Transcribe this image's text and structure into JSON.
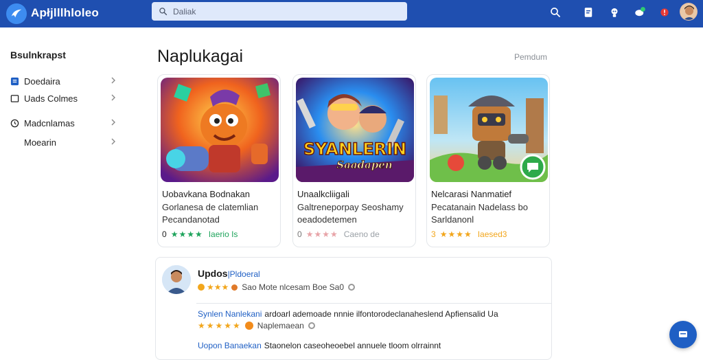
{
  "header": {
    "app_title": "Apłjlllhloleo",
    "search_placeholder": "Daliak",
    "accent_color": "#1f4fb0",
    "icons": [
      "search-icon",
      "document-icon",
      "support-icon",
      "chat-notification-icon",
      "alert-icon",
      "user-avatar"
    ]
  },
  "sidebar": {
    "title": "Bsulnkrapst",
    "items": [
      {
        "label": "Doedaira",
        "icon": "list-icon"
      },
      {
        "label": "Uads Colmes",
        "icon": "square-icon"
      },
      {
        "label": "Madcnlamas",
        "icon": "clock-icon"
      },
      {
        "label": "Moearin",
        "icon": ""
      }
    ]
  },
  "main": {
    "section_title": "Naplukagai",
    "section_link": "Pemdum",
    "cards": [
      {
        "title": "Uobavkana Bodnakan",
        "desc": "Gorlanesa de clatemlian Pecandanotad",
        "rating_value": "0",
        "stars": "★★★★",
        "star_color": "#1fa45c",
        "count": "Iaerio Is",
        "count_color": "#1fa45c"
      },
      {
        "title": "Unaalkcliigali",
        "desc": "Galtreneporpay Seoshamy oeadodetemen",
        "rating_value": "0",
        "stars": "★★★★",
        "star_color": "#e8a4a8",
        "count": "Caeno de",
        "count_color": "#9aa0a6",
        "art_text_1": "SYANLERIN",
        "art_text_2": "Saadapen"
      },
      {
        "title": "Nelcarasi Nanmatief",
        "desc": "Pecatanain Nadelass bo Sarldanonl",
        "rating_value": "3",
        "stars": "★★★★",
        "star_color": "#f2a61c",
        "count": "Iaesed3",
        "count_color": "#f2a61c"
      }
    ]
  },
  "reviews": {
    "author_name": "Updos",
    "author_role": "|Pldoeral",
    "author_stars": "★★★",
    "author_meta": "Sao Mote nlcesam Boe Sa0",
    "lines": [
      {
        "name": "Synlen Nanlekani",
        "text": "ardoarl ademoade nnnie ilfontorodeclanaheslend Apfiensalid Ua"
      },
      {
        "name": "Uopon Banaekan",
        "text": "Staonelon caseoheoebel annuele tloom olrrainnt"
      }
    ],
    "line_stars": "★★★★★",
    "line_meta": "Naplemaean"
  },
  "fab": {
    "icon": "message-icon"
  }
}
